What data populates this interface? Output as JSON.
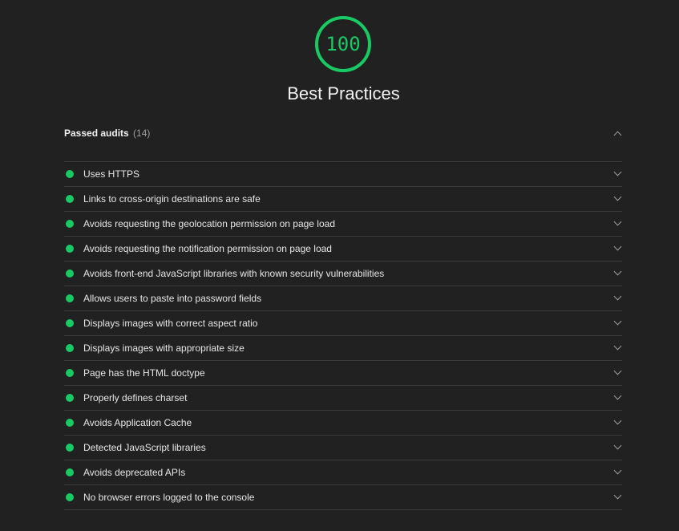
{
  "score": {
    "value": "100",
    "fraction": 1.0,
    "color": "#18c964",
    "track_color": "#1b3b27"
  },
  "category": {
    "title": "Best Practices"
  },
  "passed_group": {
    "title": "Passed audits",
    "count": "(14)",
    "expanded": true,
    "status_color": "#18c964",
    "audits": [
      {
        "label": "Uses HTTPS"
      },
      {
        "label": "Links to cross-origin destinations are safe"
      },
      {
        "label": "Avoids requesting the geolocation permission on page load"
      },
      {
        "label": "Avoids requesting the notification permission on page load"
      },
      {
        "label": "Avoids front-end JavaScript libraries with known security vulnerabilities"
      },
      {
        "label": "Allows users to paste into password fields"
      },
      {
        "label": "Displays images with correct aspect ratio"
      },
      {
        "label": "Displays images with appropriate size"
      },
      {
        "label": "Page has the HTML doctype"
      },
      {
        "label": "Properly defines charset"
      },
      {
        "label": "Avoids Application Cache"
      },
      {
        "label": "Detected JavaScript libraries"
      },
      {
        "label": "Avoids deprecated APIs"
      },
      {
        "label": "No browser errors logged to the console"
      }
    ]
  }
}
